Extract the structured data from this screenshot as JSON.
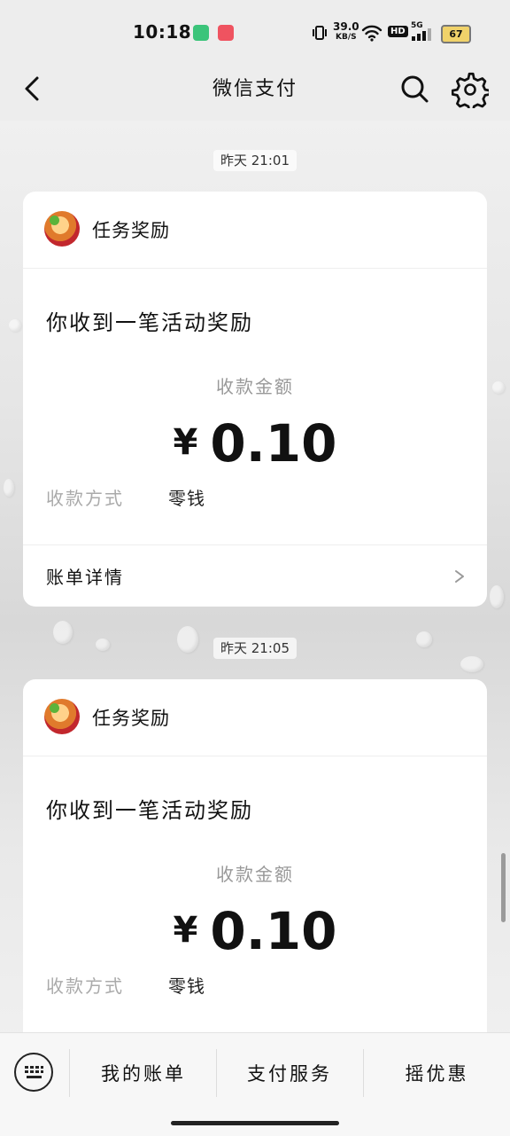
{
  "status_bar": {
    "time": "10:18",
    "net_speed": "39.0",
    "net_unit": "KB/S",
    "hd": "HD",
    "signal": "5G",
    "battery": "67"
  },
  "header": {
    "title": "微信支付"
  },
  "messages": [
    {
      "timestamp": "昨天 21:01",
      "sender": "任务奖励",
      "text": "你收到一笔活动奖励",
      "amount_label": "收款金额",
      "currency": "¥",
      "amount": "0.10",
      "method_label": "收款方式",
      "method_value": "零钱",
      "detail_label": "账单详情"
    },
    {
      "timestamp": "昨天 21:05",
      "sender": "任务奖励",
      "text": "你收到一笔活动奖励",
      "amount_label": "收款金额",
      "currency": "¥",
      "amount": "0.10",
      "method_label": "收款方式",
      "method_value": "零钱"
    }
  ],
  "bottom_menu": {
    "items": [
      "我的账单",
      "支付服务",
      "摇优惠"
    ]
  }
}
